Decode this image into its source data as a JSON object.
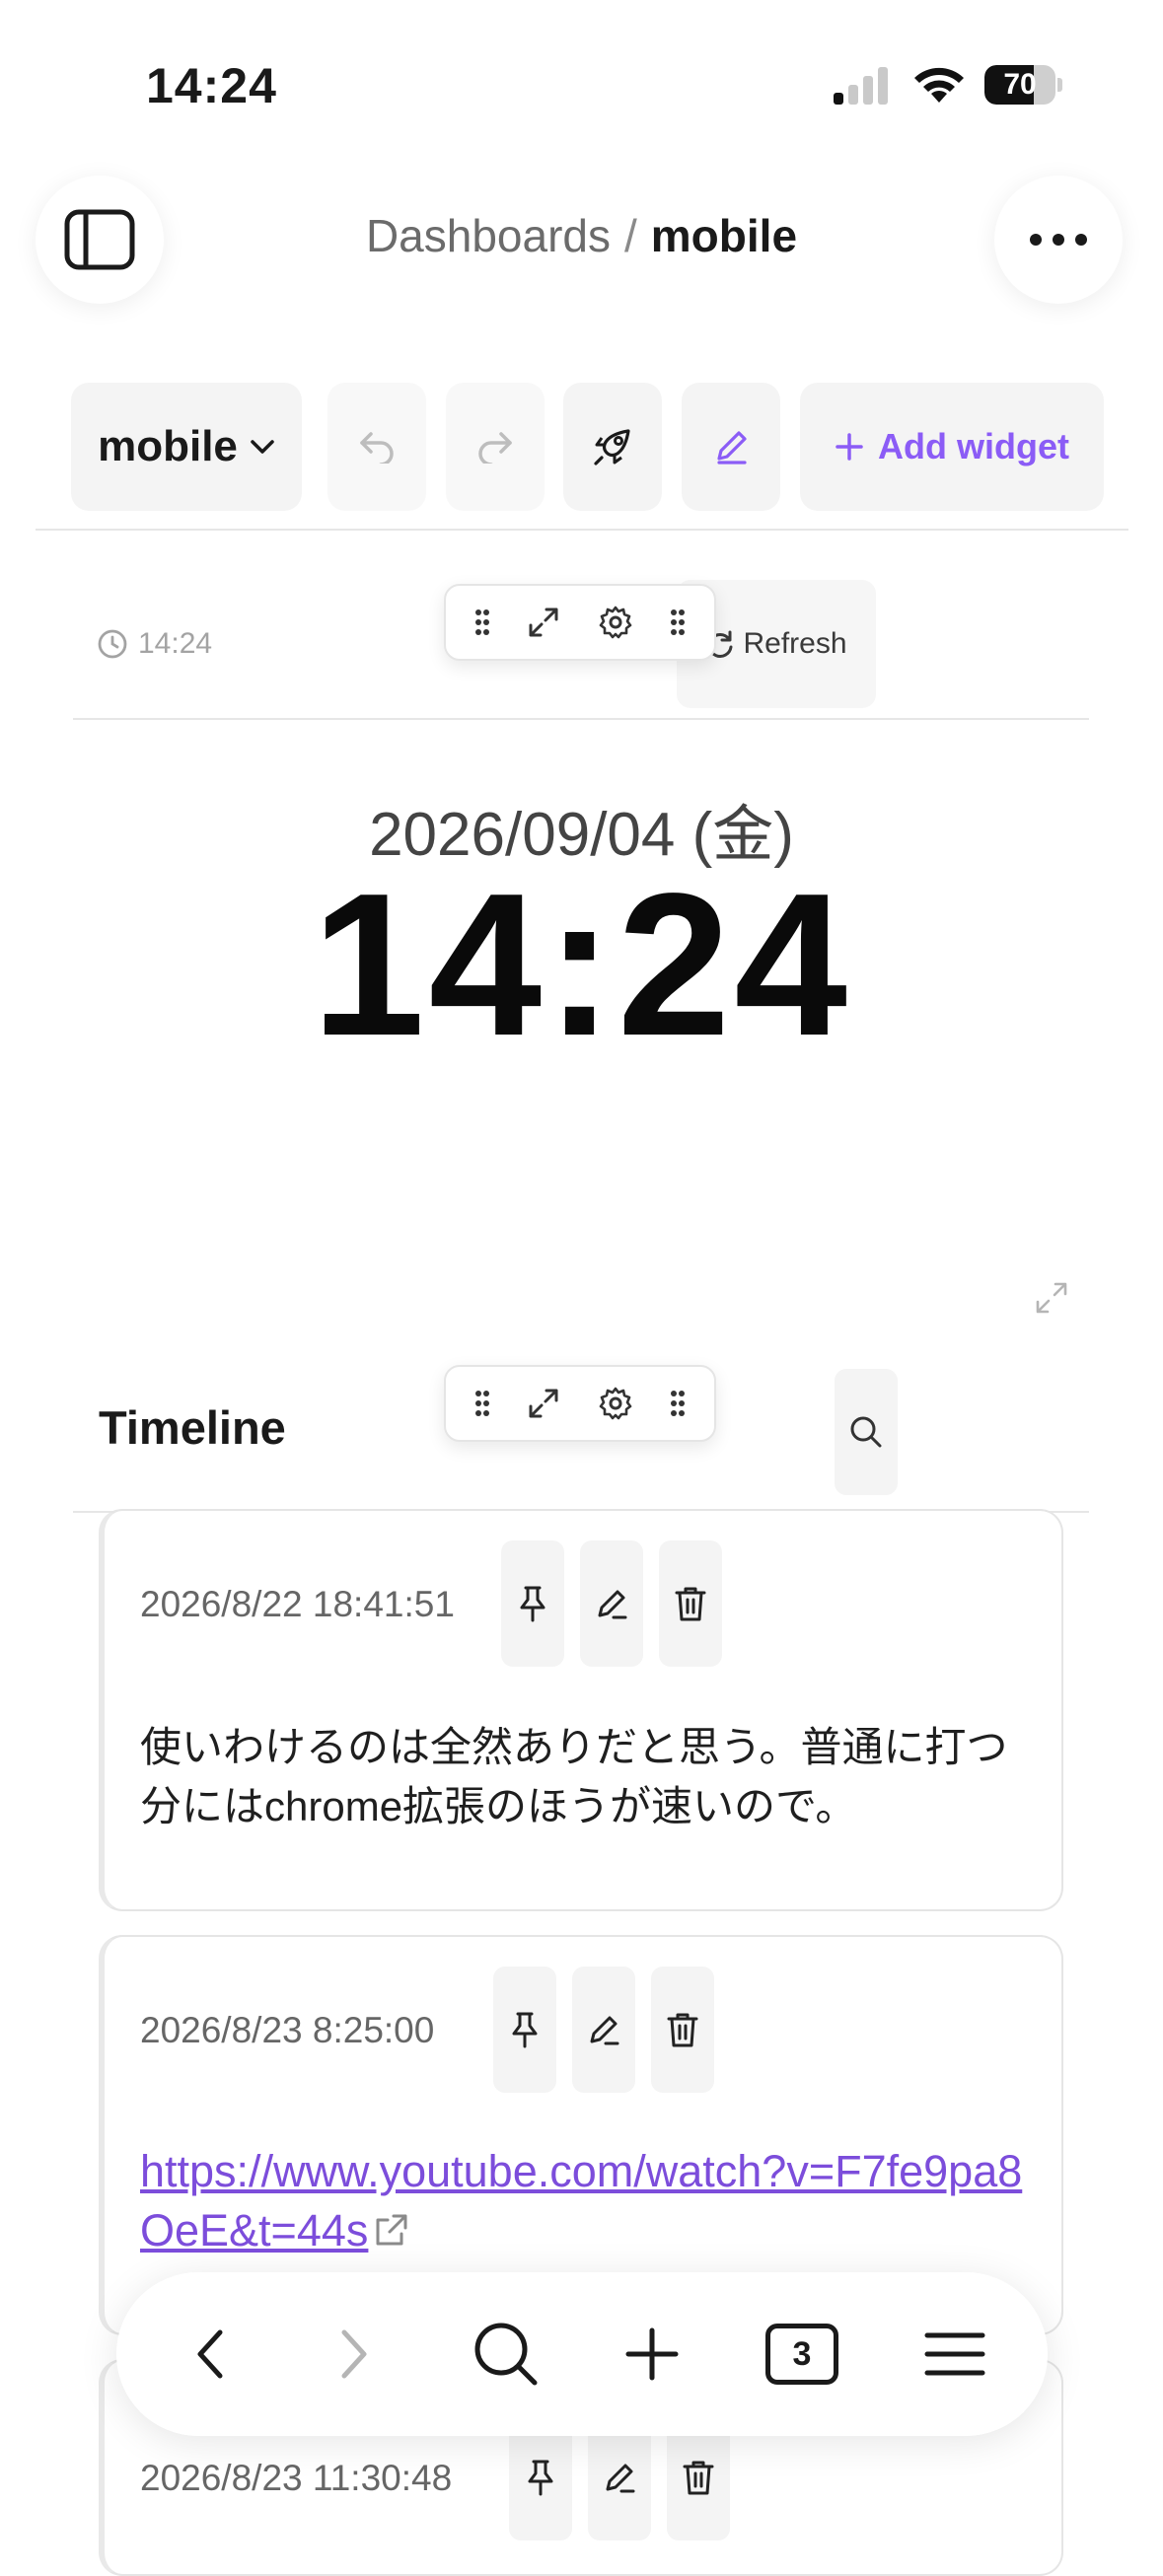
{
  "status_bar": {
    "time": "14:24",
    "battery_level": 70,
    "battery_text": "70"
  },
  "header": {
    "breadcrumb_parent": "Dashboards",
    "breadcrumb_separator": "/",
    "breadcrumb_current": "mobile"
  },
  "toolbar": {
    "dashboard_select_value": "mobile",
    "add_widget_label": "Add widget"
  },
  "clock_widget": {
    "small_time": "14:24",
    "refresh_label": "Refresh",
    "date": "2026/09/04 (金)",
    "time": "14:24"
  },
  "timeline_widget": {
    "title": "Timeline",
    "entries": [
      {
        "timestamp": "2026/8/22 18:41:51",
        "text": "使いわけるのは全然ありだと思う。普通に打つ分にはchrome拡張のほうが速いので。"
      },
      {
        "timestamp": "2026/8/23 8:25:00",
        "link": "https://www.youtube.com/watch?v=F7fe9pa8OeE&t=44s"
      },
      {
        "timestamp": "2026/8/23 11:30:48"
      }
    ]
  },
  "browser_bar": {
    "tab_count": "3"
  },
  "colors": {
    "accent": "#8b5cf6",
    "link": "#7c4ddb",
    "muted": "#a3a3a3",
    "border": "#e5e5e5"
  }
}
